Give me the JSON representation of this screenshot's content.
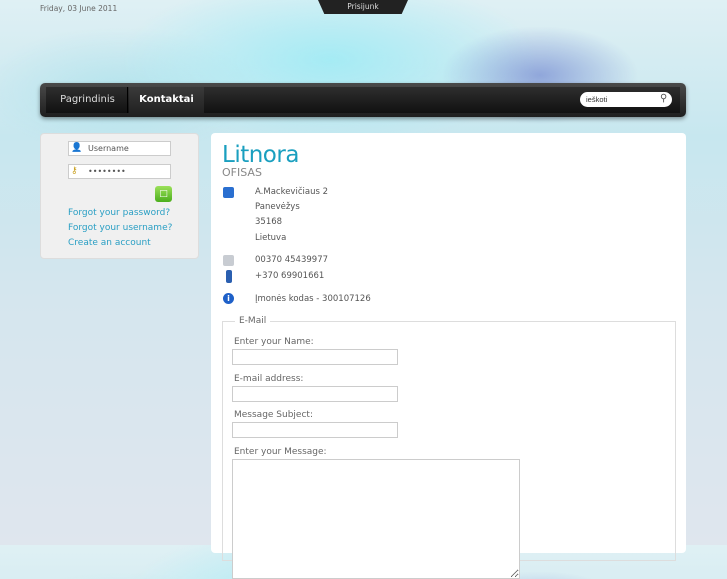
{
  "header": {
    "date": "Friday, 03 June 2011",
    "login_tab": "Prisijunk"
  },
  "nav": {
    "items": [
      {
        "label": "Pagrindinis"
      },
      {
        "label": "Kontaktai",
        "active": true
      }
    ],
    "search_value": "ieškoti"
  },
  "login": {
    "username_placeholder": "Username",
    "password_value": "••••••••",
    "links": [
      "Forgot your password?",
      "Forgot your username?",
      "Create an account"
    ]
  },
  "contact": {
    "title": "Litnora",
    "subtitle": "OFISAS",
    "address": [
      "A.Mackevičiaus 2",
      "Panevėžys",
      "35168",
      "Lietuva"
    ],
    "fax": "00370 45439977",
    "mobile": "+370 69901661",
    "company_code": "Įmonės kodas - 300107126"
  },
  "form": {
    "legend": "E-Mail",
    "name_label": "Enter your Name:",
    "email_label": "E-mail address:",
    "subject_label": "Message Subject:",
    "message_label": "Enter your Message:"
  },
  "colors": {
    "accent": "#1a9fbf",
    "link": "#2a9fc4"
  }
}
